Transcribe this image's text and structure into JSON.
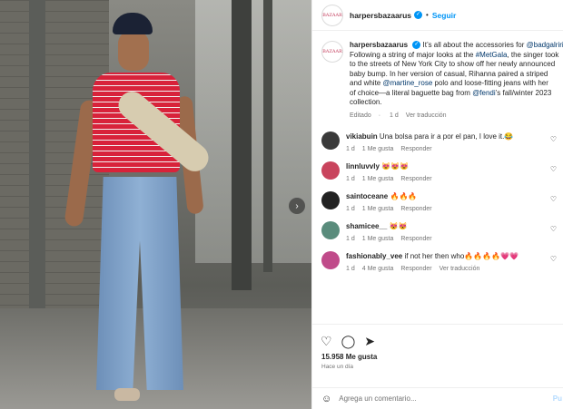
{
  "header": {
    "avatar_text": "BAZAAR",
    "username": "harpersbazaarus",
    "separator": "•",
    "follow_label": "Seguir"
  },
  "caption": {
    "avatar_text": "BAZAAR",
    "lines": [
      "harpersbazaarus",
      "It’s all about the accessories for ",
      "@badgalriri",
      "Following a string of major looks at the ",
      "#MetGala",
      ", the singer took",
      "to the streets of New York City to show off her newly announced",
      "baby bump. In her version of casual, Rihanna paired a striped",
      "and white ",
      "@martine_rose",
      " polo and loose-fitting jeans with her",
      "of choice—a literal baguette bag from ",
      "@fendi",
      "’s fall/winter 2023",
      "collection."
    ],
    "meta": {
      "edited": "Editado",
      "dot": "·",
      "time": "1 d",
      "translation": "Ver traducción"
    }
  },
  "comments": [
    {
      "user": "vikiabuin",
      "text": "Una bolsa para ir a por el pan, I love it.😂",
      "time": "1 d",
      "likes": "1 Me gusta",
      "reply": "Responder",
      "translation": ""
    },
    {
      "user": "linnluvvly",
      "text": "😻😻😻",
      "time": "1 d",
      "likes": "1 Me gusta",
      "reply": "Responder",
      "translation": ""
    },
    {
      "user": "saintoceane",
      "text": "🔥🔥🔥",
      "time": "1 d",
      "likes": "1 Me gusta",
      "reply": "Responder",
      "translation": ""
    },
    {
      "user": "shamicee__",
      "text": "😻😻",
      "time": "1 d",
      "likes": "1 Me gusta",
      "reply": "Responder",
      "translation": ""
    },
    {
      "user": "fashionably_vee",
      "text": "if not her then who🔥🔥🔥🔥💗💗",
      "time": "1 d",
      "likes": "4 Me gusta",
      "reply": "Responder",
      "translation": "Ver traducción"
    }
  ],
  "actions": {
    "likes": "15.958 Me gusta",
    "ago": "Hace un día"
  },
  "add_comment": {
    "placeholder": "Agrega un comentario...",
    "publish": "Pu"
  },
  "colors": {
    "accent": "#0095f6",
    "stripe_red": "#d8223a"
  }
}
